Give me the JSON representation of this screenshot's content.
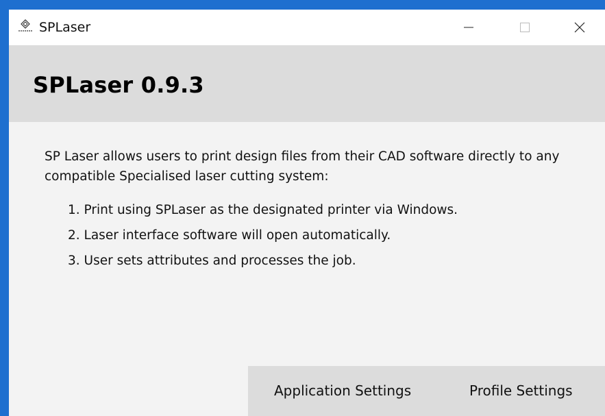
{
  "window": {
    "title": "SPLaser",
    "icon": "splaser-logo-icon",
    "controls": {
      "minimize": "minimize-icon",
      "maximize": "maximize-icon",
      "close": "close-icon"
    }
  },
  "header": {
    "title": "SPLaser 0.9.3"
  },
  "main": {
    "intro": "SP Laser allows users to print design files from their CAD software directly to any compatible Specialised laser cutting system:",
    "steps": [
      "1. Print using SPLaser as the designated printer via Windows.",
      "2. Laser interface software will open automatically.",
      "3. User sets attributes and processes the job."
    ]
  },
  "footer": {
    "application_settings_label": "Application Settings",
    "profile_settings_label": "Profile Settings"
  },
  "colors": {
    "desktop": "#1e6fcf",
    "titlebar": "#ffffff",
    "header_band": "#dcdcdc",
    "content_bg": "#f3f3f3",
    "footer_bar": "#dcdcdc"
  }
}
